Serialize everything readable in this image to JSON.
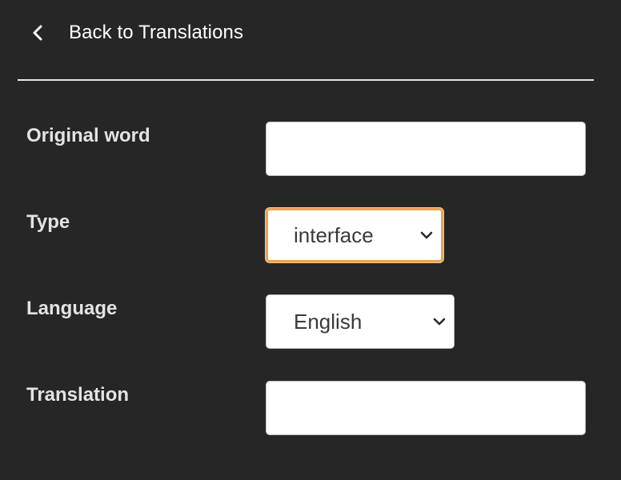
{
  "nav": {
    "back_label": "Back to Translations",
    "back_icon": "chevron-left-icon"
  },
  "form": {
    "original_word": {
      "label": "Original word",
      "value": ""
    },
    "type": {
      "label": "Type",
      "selected": "interface",
      "icon": "chevron-down-icon"
    },
    "language": {
      "label": "Language",
      "selected": "English",
      "icon": "chevron-down-icon"
    },
    "translation": {
      "label": "Translation",
      "value": ""
    }
  },
  "colors": {
    "background": "#262626",
    "text": "#ffffff",
    "label": "#e3e3e3",
    "focus_ring": "#e8a557"
  }
}
